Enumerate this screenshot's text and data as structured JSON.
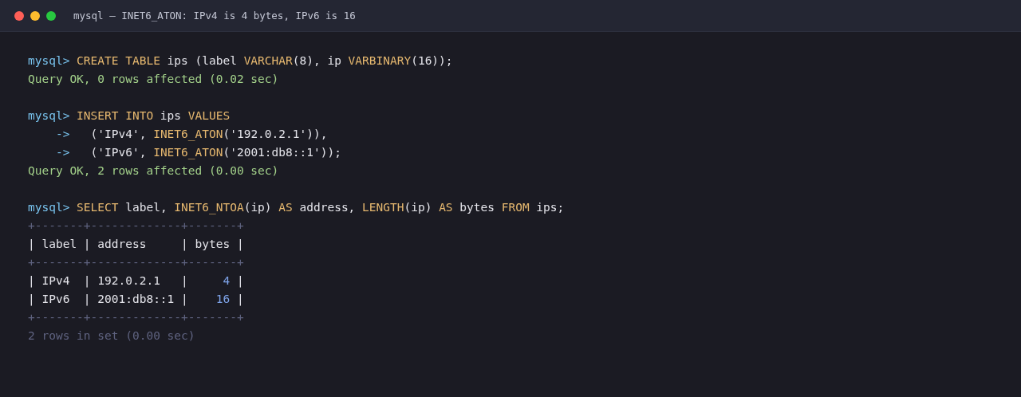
{
  "window": {
    "title": "mysql — INET6_ATON: IPv4 is 4 bytes, IPv6 is 16"
  },
  "blocks": [
    [
      [
        {
          "kind": "prompt",
          "text": "mysql> "
        },
        {
          "kind": "keyword",
          "text": "CREATE TABLE"
        },
        {
          "kind": "plain",
          "text": " ips (label "
        },
        {
          "kind": "keyword",
          "text": "VARCHAR"
        },
        {
          "kind": "plain",
          "text": "(8), ip "
        },
        {
          "kind": "keyword",
          "text": "VARBINARY"
        },
        {
          "kind": "plain",
          "text": "(16));"
        }
      ],
      [
        {
          "kind": "ok",
          "text": "Query OK, 0 rows affected (0.02 sec)"
        }
      ]
    ],
    [
      [
        {
          "kind": "prompt",
          "text": "mysql> "
        },
        {
          "kind": "keyword",
          "text": "INSERT INTO"
        },
        {
          "kind": "plain",
          "text": " ips "
        },
        {
          "kind": "keyword",
          "text": "VALUES"
        }
      ],
      [
        {
          "kind": "prompt",
          "text": "    ->   "
        },
        {
          "kind": "plain",
          "text": "('IPv4', "
        },
        {
          "kind": "keyword",
          "text": "INET6_ATON"
        },
        {
          "kind": "plain",
          "text": "('192.0.2.1')),"
        }
      ],
      [
        {
          "kind": "prompt",
          "text": "    ->   "
        },
        {
          "kind": "plain",
          "text": "('IPv6', "
        },
        {
          "kind": "keyword",
          "text": "INET6_ATON"
        },
        {
          "kind": "plain",
          "text": "('2001:db8::1'));"
        }
      ],
      [
        {
          "kind": "ok",
          "text": "Query OK, 2 rows affected (0.00 sec)"
        }
      ]
    ],
    [
      [
        {
          "kind": "prompt",
          "text": "mysql> "
        },
        {
          "kind": "keyword",
          "text": "SELECT"
        },
        {
          "kind": "plain",
          "text": " label, "
        },
        {
          "kind": "keyword",
          "text": "INET6_NTOA"
        },
        {
          "kind": "plain",
          "text": "(ip) "
        },
        {
          "kind": "keyword",
          "text": "AS"
        },
        {
          "kind": "plain",
          "text": " address, "
        },
        {
          "kind": "keyword",
          "text": "LENGTH"
        },
        {
          "kind": "plain",
          "text": "(ip) "
        },
        {
          "kind": "keyword",
          "text": "AS"
        },
        {
          "kind": "plain",
          "text": " bytes "
        },
        {
          "kind": "keyword",
          "text": "FROM"
        },
        {
          "kind": "plain",
          "text": " ips;"
        }
      ],
      [
        {
          "kind": "dim",
          "text": "+-------+-------------+-------+"
        }
      ],
      [
        {
          "kind": "plain",
          "text": "| label | address     | bytes |"
        }
      ],
      [
        {
          "kind": "dim",
          "text": "+-------+-------------+-------+"
        }
      ],
      [
        {
          "kind": "plain",
          "text": "| IPv4  | 192.0.2.1   |     "
        },
        {
          "kind": "number",
          "text": "4"
        },
        {
          "kind": "plain",
          "text": " |"
        }
      ],
      [
        {
          "kind": "plain",
          "text": "| IPv6  | 2001:db8::1 |    "
        },
        {
          "kind": "number",
          "text": "16"
        },
        {
          "kind": "plain",
          "text": " |"
        }
      ],
      [
        {
          "kind": "dim",
          "text": "+-------+-------------+-------+"
        }
      ],
      [
        {
          "kind": "dim",
          "text": "2 rows in set (0.00 sec)"
        }
      ]
    ]
  ]
}
